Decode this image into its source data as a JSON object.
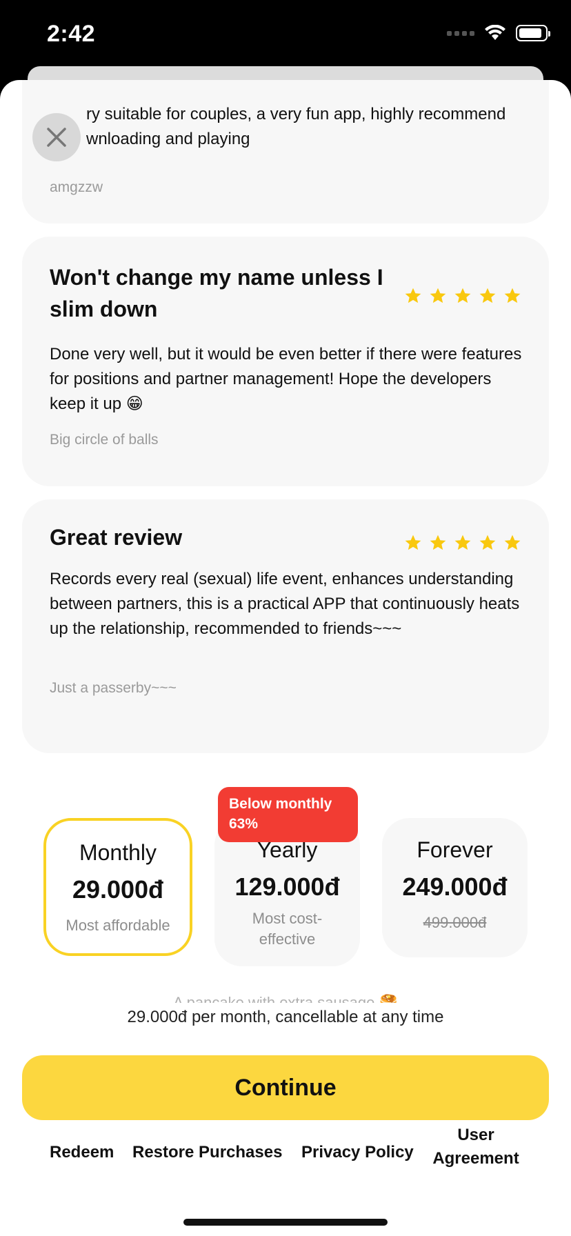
{
  "status_bar": {
    "time": "2:42"
  },
  "reviews": [
    {
      "title": "",
      "body_line1": "ry suitable for couples, a very fun app, highly recommend",
      "body_line2": "wnloading and playing",
      "author": "amgzzw"
    },
    {
      "title_line1": "Won't change my name unless I",
      "title_line2": "slim down",
      "body": "Done very well, but it would be even better if there were features for positions and partner management! Hope the developers keep it up 😁",
      "author": "Big circle of balls",
      "stars": 5
    },
    {
      "title": "Great review",
      "body": "Records every real (sexual) life event, enhances understanding between partners, this is a practical APP that continuously heats up the relationship, recommended to friends~~~",
      "author": "Just a passerby~~~",
      "stars": 5
    }
  ],
  "plans": {
    "monthly": {
      "name": "Monthly",
      "price": "29.000đ",
      "note": "Most affordable",
      "selected": true
    },
    "yearly": {
      "name": "Yearly",
      "price": "129.000đ",
      "note_line1": "Most cost-",
      "note_line2": "effective",
      "badge_line1": "Below monthly",
      "badge_line2": "63%"
    },
    "forever": {
      "name": "Forever",
      "price": "249.000đ",
      "original_price": "499.000đ"
    }
  },
  "teaser": "A pancake with extra sausage 🥞",
  "price_summary": "29.000đ per month, cancellable at any time",
  "continue_label": "Continue",
  "footer": {
    "redeem": "Redeem",
    "restore": "Restore Purchases",
    "privacy": "Privacy Policy",
    "agreement_line1": "User",
    "agreement_line2": "Agreement"
  },
  "colors": {
    "accent": "#fcd73f",
    "selected_border": "#f9d224",
    "badge": "#f23c33",
    "star": "#f9c80e"
  }
}
